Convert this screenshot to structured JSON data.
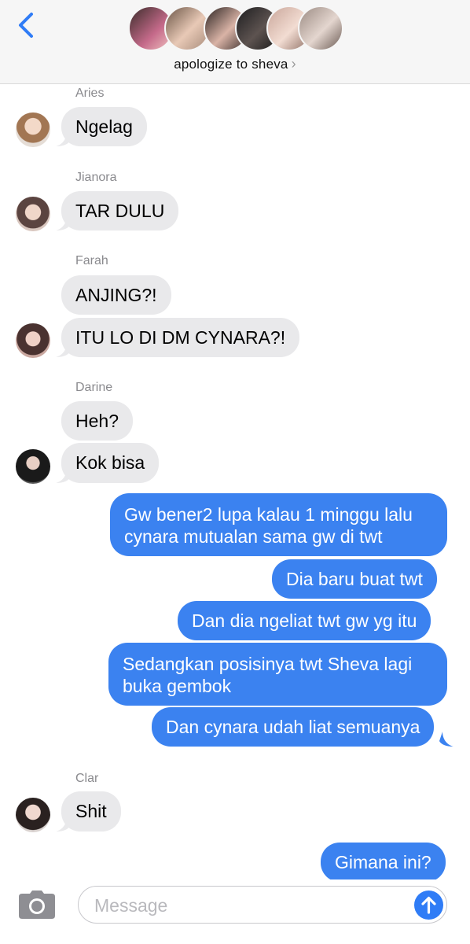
{
  "header": {
    "group_name": "apologize to sheva",
    "chevron": "›"
  },
  "messages": [
    {
      "sender": "Aries",
      "text": "Ngelag"
    },
    {
      "sender": "Jianora",
      "text": "TAR DULU"
    },
    {
      "sender": "Farah",
      "texts": [
        "ANJING?!",
        "ITU LO DI DM CYNARA?!"
      ]
    },
    {
      "sender": "Darine",
      "texts": [
        "Heh?",
        "Kok bisa"
      ]
    },
    {
      "outgoing": [
        [
          "Gw bener2 lupa kalau 1 minggu lalu",
          "cynara mutualan sama gw di twt"
        ],
        [
          "Dia baru buat twt"
        ],
        [
          "Dan dia ngeliat twt gw yg itu"
        ],
        [
          "Sedangkan posisinya twt Sheva lagi",
          "buka gembok"
        ],
        [
          "Dan cynara udah liat semuanya"
        ]
      ]
    },
    {
      "sender": "Clar",
      "text": "Shit"
    },
    {
      "outgoing_last": "Gimana ini?"
    }
  ],
  "composer": {
    "placeholder": "Message"
  },
  "icons": {
    "back": "chevron-left-icon",
    "camera": "camera-icon",
    "send": "arrow-up-icon"
  },
  "colors": {
    "accent": "#2f7cf6",
    "outgoing_bubble": "#3b82f0",
    "incoming_bubble": "#e9e9eb"
  }
}
